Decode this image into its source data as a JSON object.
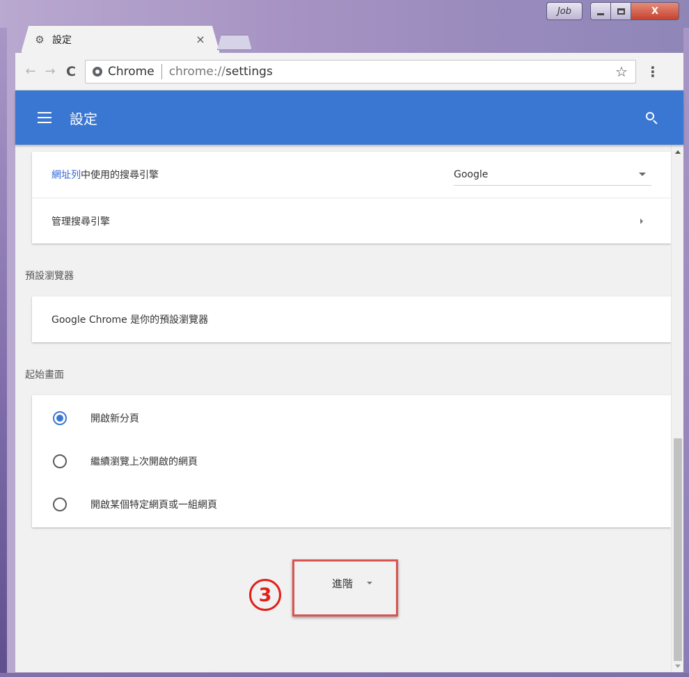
{
  "window": {
    "profile_label": "Job",
    "close_glyph": "X"
  },
  "tab": {
    "title": "設定",
    "icon": "gear-icon",
    "close_glyph": "×"
  },
  "toolbar": {
    "back_glyph": "←",
    "forward_glyph": "→",
    "reload_glyph": "C",
    "site_name": "Chrome",
    "url_scheme": "chrome://",
    "url_path": "settings",
    "star_glyph": "☆",
    "menu_glyph": "⋮"
  },
  "appbar": {
    "title": "設定",
    "background": "#3a77d3"
  },
  "search_engine": {
    "row_label_link": "網址列",
    "row_label_rest": "中使用的搜尋引擎",
    "selected": "Google",
    "manage_label": "管理搜尋引擎"
  },
  "default_browser": {
    "section_title": "預設瀏覽器",
    "status": "Google Chrome 是你的預設瀏覽器"
  },
  "startup": {
    "section_title": "起始畫面",
    "options": [
      {
        "label": "開啟新分頁",
        "checked": true
      },
      {
        "label": "繼續瀏覽上次開啟的網頁",
        "checked": false
      },
      {
        "label": "開啟某個特定網頁或一組網頁",
        "checked": false
      }
    ]
  },
  "advanced": {
    "label": "進階"
  },
  "annotation": {
    "step_number": "3",
    "color": "#e0201a"
  }
}
